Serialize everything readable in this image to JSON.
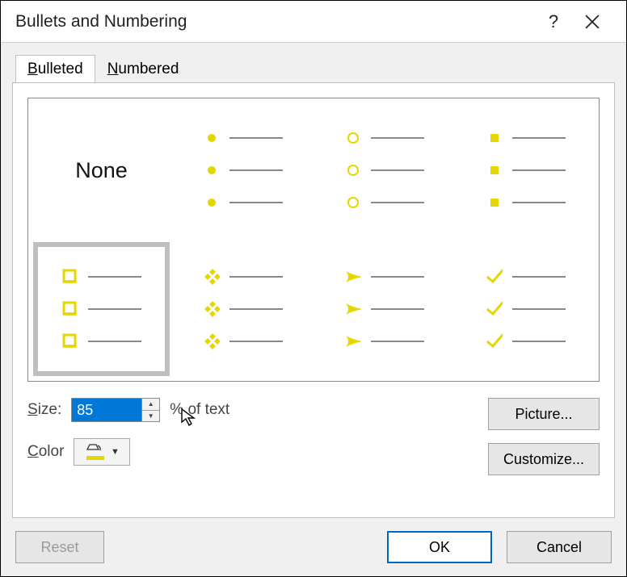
{
  "window": {
    "title": "Bullets and Numbering"
  },
  "tabs": {
    "bulleted": "Bulleted",
    "numbered": "Numbered"
  },
  "gallery": {
    "none_label": "None",
    "selected_index": 4,
    "styles": [
      "none",
      "disc",
      "circle",
      "square",
      "hollow-square",
      "diamond-cluster",
      "arrowhead",
      "checkmark"
    ]
  },
  "size": {
    "label": "Size:",
    "value": "85",
    "suffix": "% of text"
  },
  "color": {
    "label": "Color",
    "value": "#e4d600"
  },
  "buttons": {
    "picture": "Picture...",
    "customize": "Customize...",
    "reset": "Reset",
    "ok": "OK",
    "cancel": "Cancel"
  }
}
